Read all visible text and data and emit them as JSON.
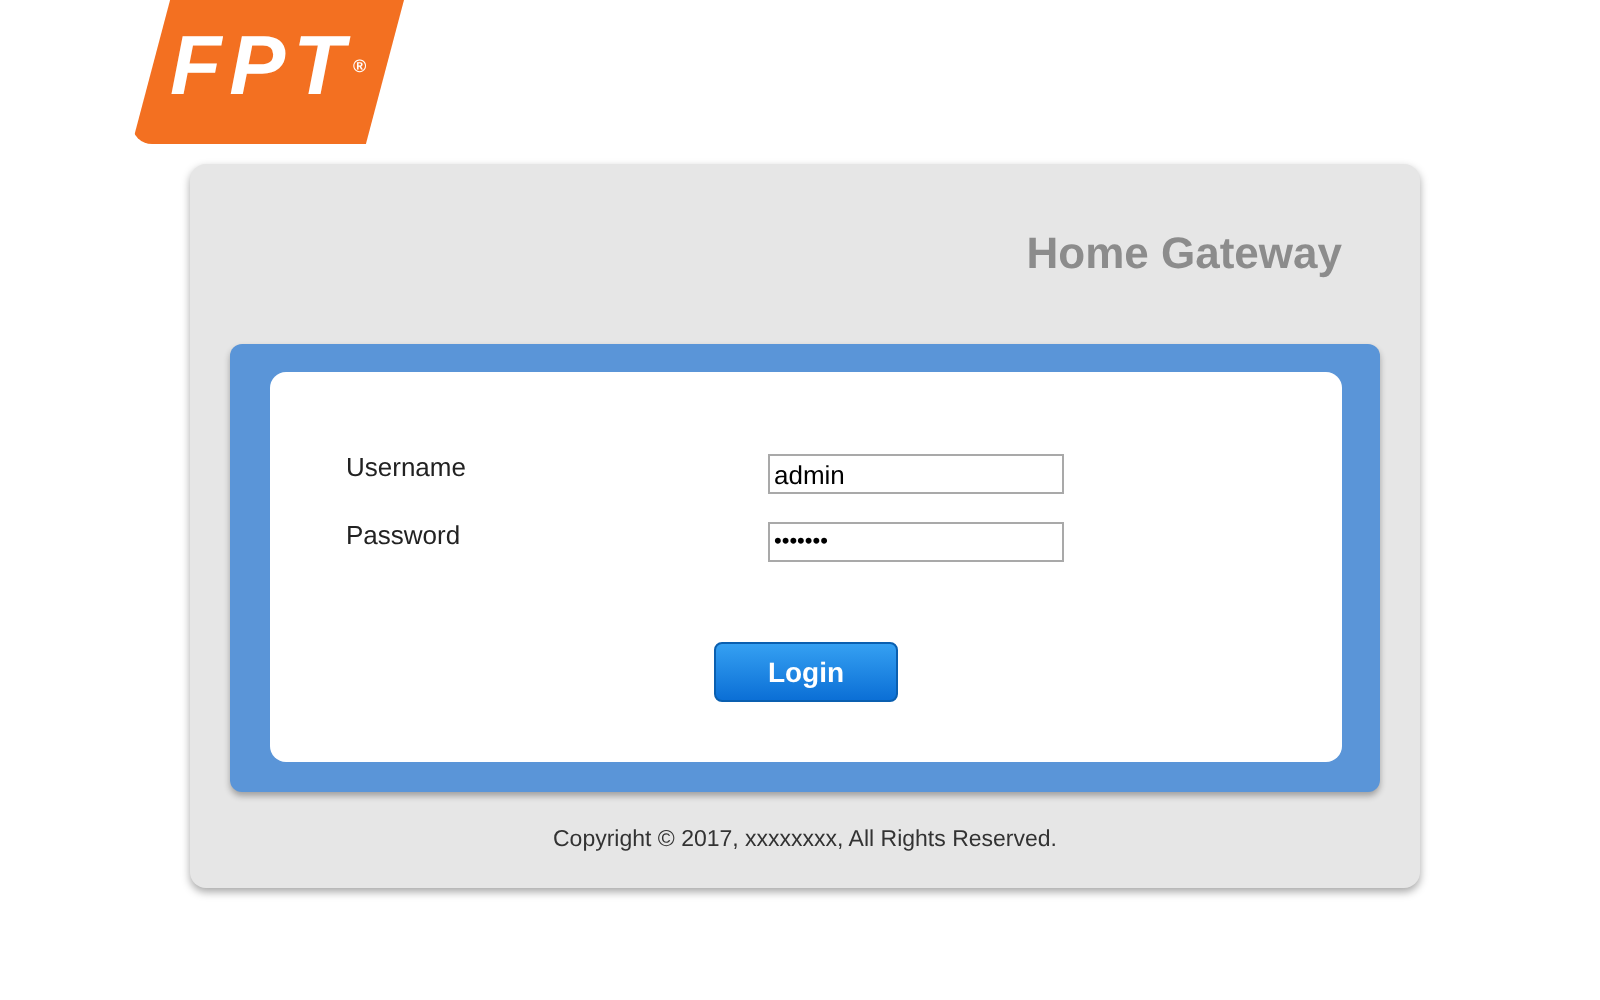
{
  "logo": {
    "text": "FPT$^{®}$"
  },
  "header": {
    "title": "Home Gateway"
  },
  "form": {
    "fields": [
      {
        "label": "Username",
        "kind": "text",
        "value": "admin"
      },
      {
        "label": "Password",
        "kind": "password",
        "value": "•••••••"
      }
    ],
    "button": "Login"
  },
  "footer": {
    "copyright": "Copyright © 2017, xxxxxxxx, All Rights Reserved."
  }
}
